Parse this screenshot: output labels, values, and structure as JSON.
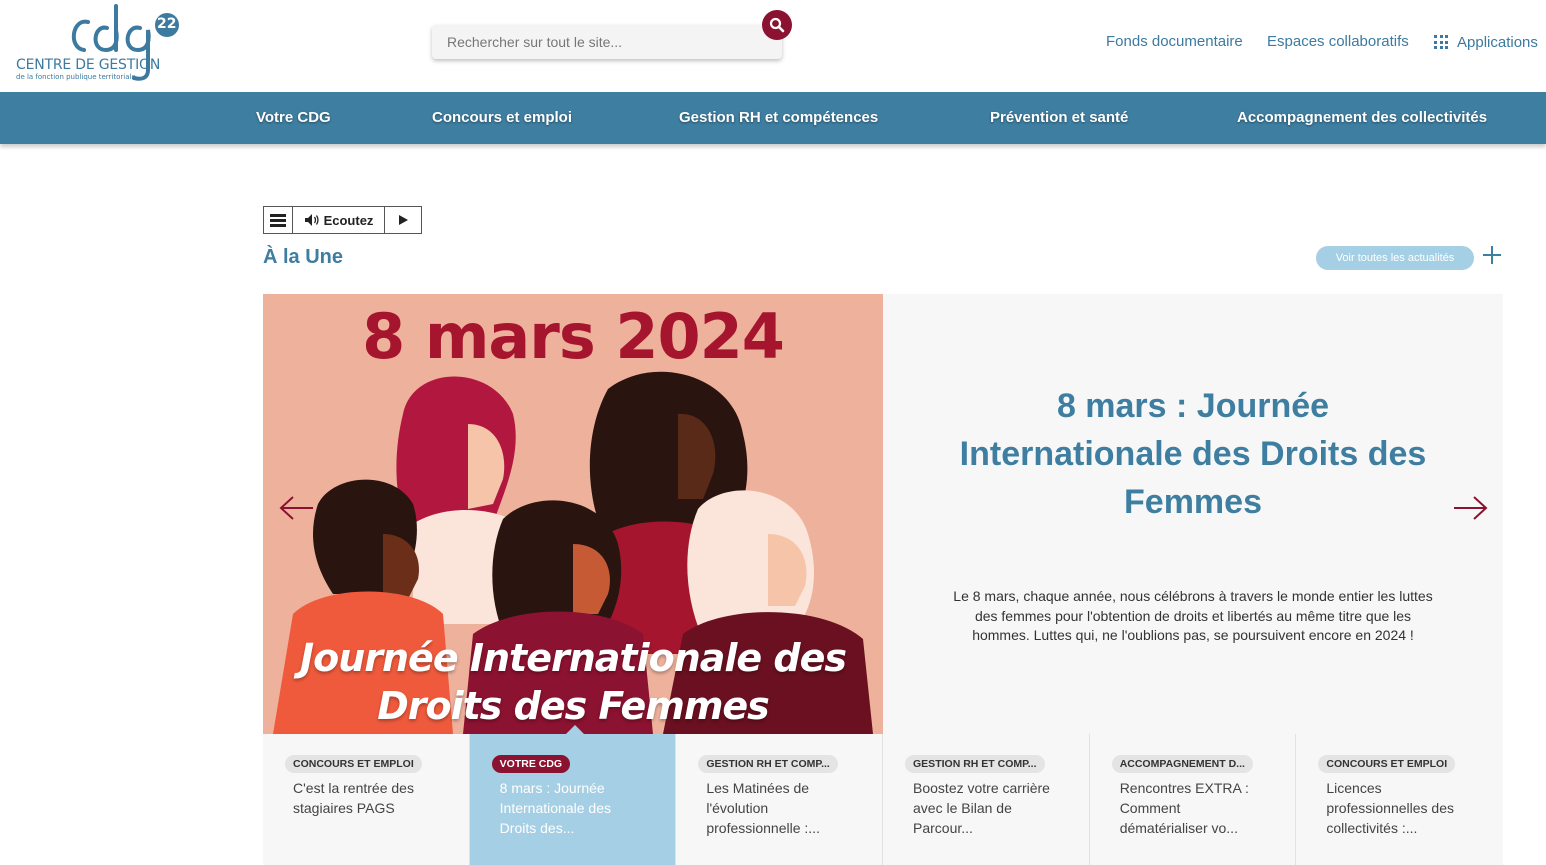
{
  "logo": {
    "brand_number": "22",
    "name": "CENTRE DE GESTION",
    "subtitle": "de la fonction publique territoriale"
  },
  "search": {
    "placeholder": "Rechercher sur tout le site..."
  },
  "top_links": {
    "fonds": "Fonds documentaire",
    "espaces": "Espaces collaboratifs",
    "applications": "Applications"
  },
  "nav": {
    "items": [
      "Votre CDG",
      "Concours et emploi",
      "Gestion RH et compétences",
      "Prévention et santé",
      "Accompagnement des collectivités"
    ]
  },
  "reader": {
    "listen_label": "Ecoutez"
  },
  "section": {
    "title": "À la Une",
    "voir_label": "Voir toutes les actualités"
  },
  "slide": {
    "image_date": "8 mars 2024",
    "image_caption_line1": "Journée Internationale des",
    "image_caption_line2": "Droits des Femmes",
    "heading": "8 mars : Journée Internationale des Droits des Femmes",
    "description": "Le 8 mars, chaque année, nous célébrons à travers le monde entier les luttes des femmes pour l'obtention de droits et libertés au même titre que les hommes. Luttes qui, ne l'oublions pas, se poursuivent encore en 2024 !"
  },
  "tabs": [
    {
      "badge": "CONCOURS ET EMPLOI",
      "title": "C'est la rentrée des stagiaires PAGS"
    },
    {
      "badge": "VOTRE CDG",
      "title": "8 mars : Journée Internationale des Droits des..."
    },
    {
      "badge": "GESTION RH ET COMP...",
      "title": "Les Matinées de l'évolution professionnelle :..."
    },
    {
      "badge": "GESTION RH ET COMP...",
      "title": "Boostez votre carrière avec le Bilan de Parcour..."
    },
    {
      "badge": "ACCOMPAGNEMENT D...",
      "title": "Rencontres EXTRA : Comment dématérialiser vo..."
    },
    {
      "badge": "CONCOURS ET EMPLOI",
      "title": "Licences professionnelles des collectivités :..."
    }
  ],
  "colors": {
    "primary_blue": "#3e7ea1",
    "accent_red": "#8b1230",
    "light_blue": "#a5cfe4"
  }
}
